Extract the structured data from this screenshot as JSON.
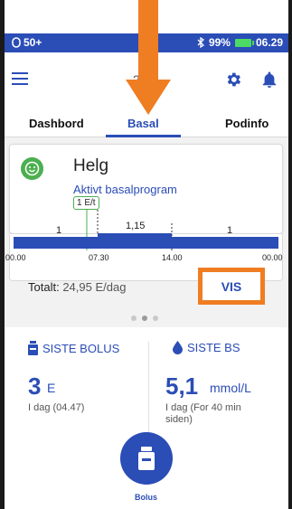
{
  "status_bar": {
    "signal": "50+",
    "battery_pct": "99%",
    "time": "06.29"
  },
  "header": {
    "title": "2..."
  },
  "tabs": [
    {
      "label": "Dashbord"
    },
    {
      "label": "Basal"
    },
    {
      "label": "Podinfo"
    }
  ],
  "program": {
    "name": "Helg",
    "subtitle": "Aktivt basalprogram",
    "current_rate": "1 E/t",
    "segment_values": [
      "1",
      "1,15",
      "1"
    ],
    "time_labels": [
      "00.00",
      "07.30",
      "14.00",
      "00.00"
    ],
    "total_label": "Totalt:",
    "total_value": "24,95 E/dag",
    "view_button": "VIS"
  },
  "last_bolus": {
    "title": "SISTE BOLUS",
    "value": "3",
    "unit": "E",
    "note": "I dag (04.47)"
  },
  "last_bg": {
    "title": "SISTE BS",
    "value": "5,1",
    "unit": "mmol/L",
    "note_line1": "I dag (For 40 min",
    "note_line2": "siden)"
  },
  "bolus_button": {
    "label": "Bolus"
  },
  "colors": {
    "primary": "#2b4db6",
    "accent_orange": "#ef7d22",
    "success_green": "#4caf50"
  }
}
